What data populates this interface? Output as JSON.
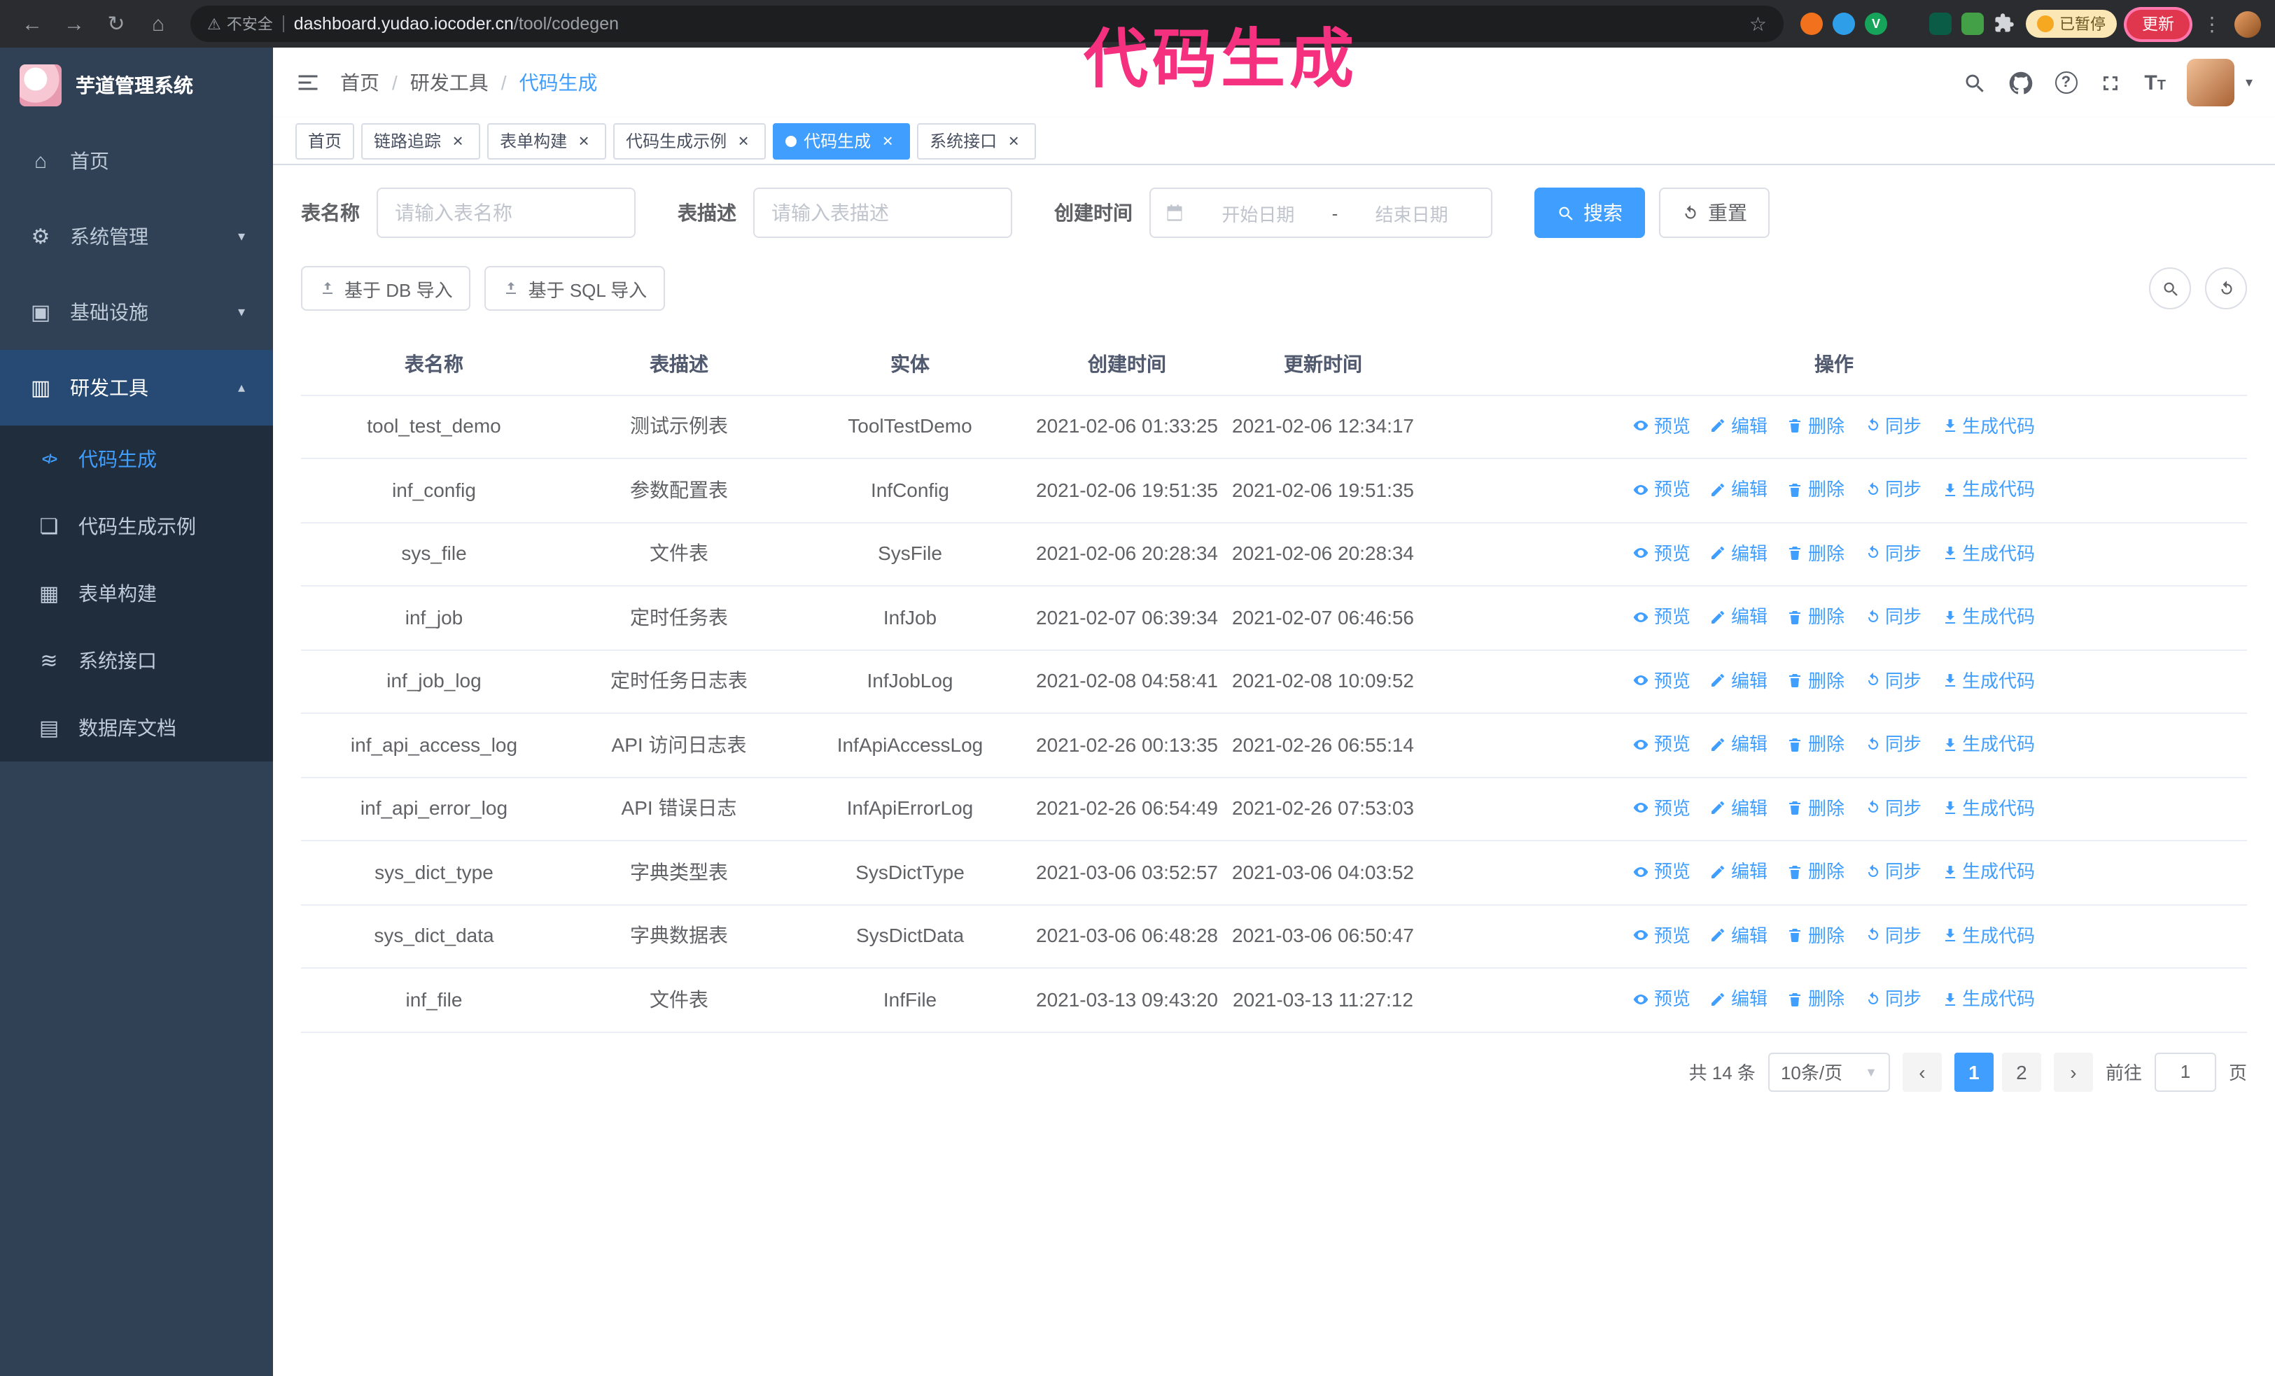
{
  "annotation": {
    "text": "代码生成"
  },
  "colors": {
    "accent": "#409eff",
    "sidebar_bg": "#304156",
    "submenu_bg": "#1f2d3d",
    "annotation_pink": "#f5317f",
    "update_red": "#e0364e",
    "paused_bg": "#fbe7b6"
  },
  "browser": {
    "security_warning": "不安全",
    "url_host": "dashboard.yudao.iocoder.cn",
    "url_path": "/tool/codegen",
    "paused_badge": "已暂停",
    "update_button": "更新"
  },
  "sidebar": {
    "app_title": "芋道管理系统",
    "menu": [
      {
        "key": "home",
        "label": "首页",
        "icon": "home",
        "icon_name": "home-icon"
      },
      {
        "key": "system",
        "label": "系统管理",
        "icon": "gear",
        "icon_name": "gear-icon",
        "chevron": "down"
      },
      {
        "key": "infra",
        "label": "基础设施",
        "icon": "infra",
        "icon_name": "monitor-icon",
        "chevron": "down"
      },
      {
        "key": "devtools",
        "label": "研发工具",
        "icon": "tools",
        "icon_name": "toolbox-icon",
        "chevron": "up",
        "open": true
      }
    ],
    "submenu": [
      {
        "key": "codegen",
        "label": "代码生成",
        "icon": "code",
        "icon_name": "code-icon",
        "active": true
      },
      {
        "key": "codegen-example",
        "label": "代码生成示例",
        "icon": "example",
        "icon_name": "example-icon"
      },
      {
        "key": "form-builder",
        "label": "表单构建",
        "icon": "form",
        "icon_name": "form-icon"
      },
      {
        "key": "api",
        "label": "系统接口",
        "icon": "api",
        "icon_name": "api-icon"
      },
      {
        "key": "db-doc",
        "label": "数据库文档",
        "icon": "db",
        "icon_name": "database-icon"
      }
    ]
  },
  "header": {
    "breadcrumb": [
      "首页",
      "研发工具",
      "代码生成"
    ]
  },
  "tabs": [
    {
      "key": "home",
      "label": "首页",
      "closable": false,
      "active": false
    },
    {
      "key": "trace",
      "label": "链路追踪",
      "closable": true,
      "active": false
    },
    {
      "key": "form-builder",
      "label": "表单构建",
      "closable": true,
      "active": false
    },
    {
      "key": "codegen-example",
      "label": "代码生成示例",
      "closable": true,
      "active": false
    },
    {
      "key": "codegen",
      "label": "代码生成",
      "closable": true,
      "active": true
    },
    {
      "key": "api",
      "label": "系统接口",
      "closable": true,
      "active": false
    }
  ],
  "filters": {
    "table_name_label": "表名称",
    "table_name_placeholder": "请输入表名称",
    "table_desc_label": "表描述",
    "table_desc_placeholder": "请输入表描述",
    "create_time_label": "创建时间",
    "date_start_placeholder": "开始日期",
    "date_separator": "-",
    "date_end_placeholder": "结束日期",
    "search_button": "搜索",
    "reset_button": "重置"
  },
  "toolbar": {
    "import_db_label": "基于 DB 导入",
    "import_sql_label": "基于 SQL 导入"
  },
  "table": {
    "columns": [
      "表名称",
      "表描述",
      "实体",
      "创建时间",
      "更新时间",
      "操作"
    ],
    "action_labels": [
      "预览",
      "编辑",
      "删除",
      "同步",
      "生成代码"
    ],
    "rows": [
      {
        "name": "tool_test_demo",
        "desc": "测试示例表",
        "entity": "ToolTestDemo",
        "created": "2021-02-06 01:33:25",
        "updated": "2021-02-06 12:34:17"
      },
      {
        "name": "inf_config",
        "desc": "参数配置表",
        "entity": "InfConfig",
        "created": "2021-02-06 19:51:35",
        "updated": "2021-02-06 19:51:35"
      },
      {
        "name": "sys_file",
        "desc": "文件表",
        "entity": "SysFile",
        "created": "2021-02-06 20:28:34",
        "updated": "2021-02-06 20:28:34"
      },
      {
        "name": "inf_job",
        "desc": "定时任务表",
        "entity": "InfJob",
        "created": "2021-02-07 06:39:34",
        "updated": "2021-02-07 06:46:56"
      },
      {
        "name": "inf_job_log",
        "desc": "定时任务日志表",
        "entity": "InfJobLog",
        "created": "2021-02-08 04:58:41",
        "updated": "2021-02-08 10:09:52"
      },
      {
        "name": "inf_api_access_log",
        "desc": "API 访问日志表",
        "entity": "InfApiAccessLog",
        "created": "2021-02-26 00:13:35",
        "updated": "2021-02-26 06:55:14"
      },
      {
        "name": "inf_api_error_log",
        "desc": "API 错误日志",
        "entity": "InfApiErrorLog",
        "created": "2021-02-26 06:54:49",
        "updated": "2021-02-26 07:53:03"
      },
      {
        "name": "sys_dict_type",
        "desc": "字典类型表",
        "entity": "SysDictType",
        "created": "2021-03-06 03:52:57",
        "updated": "2021-03-06 04:03:52"
      },
      {
        "name": "sys_dict_data",
        "desc": "字典数据表",
        "entity": "SysDictData",
        "created": "2021-03-06 06:48:28",
        "updated": "2021-03-06 06:50:47"
      },
      {
        "name": "inf_file",
        "desc": "文件表",
        "entity": "InfFile",
        "created": "2021-03-13 09:43:20",
        "updated": "2021-03-13 11:27:12"
      }
    ]
  },
  "pagination": {
    "total_label": "共 14 条",
    "page_size_label": "10条/页",
    "pages": [
      "1",
      "2"
    ],
    "active_page": "1",
    "goto_label": "前往",
    "goto_value": "1",
    "goto_unit": "页"
  }
}
